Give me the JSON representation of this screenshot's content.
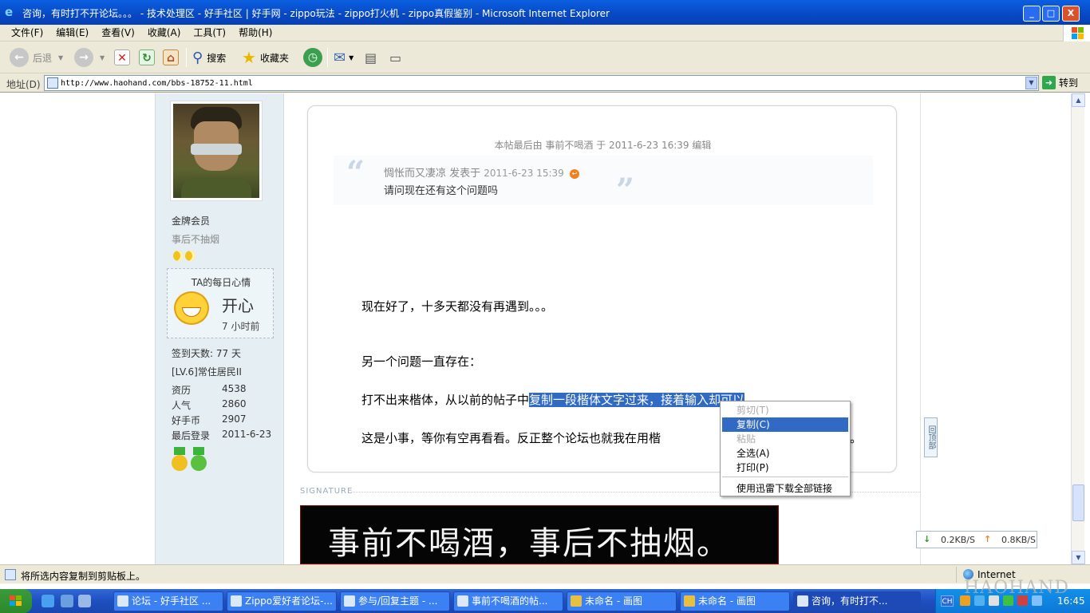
{
  "window": {
    "title": "咨询，有时打不开论坛。。。 - 技术处理区 - 好手社区 | 好手网 - zippo玩法 - zippo打火机 - zippo真假鉴别 - Microsoft Internet Explorer",
    "buttons": {
      "minimize": "_",
      "maximize": "□",
      "close": "X"
    }
  },
  "menubar": [
    "文件(F)",
    "编辑(E)",
    "查看(V)",
    "收藏(A)",
    "工具(T)",
    "帮助(H)"
  ],
  "toolbar": {
    "back": "后退",
    "search": "搜索",
    "favorites": "收藏夹"
  },
  "address": {
    "label": "地址(D)",
    "url": "http://www.haohand.com/bbs-18752-11.html",
    "go": "转到"
  },
  "user": {
    "rank": "金牌会员",
    "name": "事后不抽烟",
    "mood_title": "TA的每日心情",
    "mood": "开心",
    "mood_time": "7 小时前",
    "signin": "签到天数: 77 天",
    "level": "[LV.6]常住居民II",
    "stats": [
      {
        "key": "资历",
        "value": "4538"
      },
      {
        "key": "人气",
        "value": "2860"
      },
      {
        "key": "好手币",
        "value": "2907"
      },
      {
        "key": "最后登录",
        "value": "2011-6-23"
      }
    ]
  },
  "post": {
    "edited": "本帖最后由 事前不喝酒 于 2011-6-23 16:39 编辑",
    "quote_author": "惆怅而又凄凉 发表于",
    "quote_date": "2011-6-23 15:39",
    "quote_text": "请问现在还有这个问题吗",
    "line1": "现在好了，十多天都没有再遇到。。。",
    "line2": "另一个问题一直存在：",
    "line3_plain": "打不出来楷体，从以前的帖子中",
    "line3_selected": "复制一段楷体文字过来，接着输入却可以",
    "line4": "这是小事，等你有空再看看。反正整个论坛也就我在用楷",
    "line4_tail": "。"
  },
  "signature": {
    "label": "SIGNATURE",
    "text": "事前不喝酒，事后不抽烟。"
  },
  "backtop": "回顶部",
  "context_menu": [
    {
      "label": "剪切(T)",
      "state": "disabled"
    },
    {
      "label": "复制(C)",
      "state": "active"
    },
    {
      "label": "粘贴",
      "state": "disabled"
    },
    {
      "label": "全选(A)",
      "state": "normal"
    },
    {
      "label": "打印(P)",
      "state": "normal"
    },
    {
      "label": "使用迅雷下载全部链接",
      "state": "normal"
    }
  ],
  "speed": {
    "down": "0.2KB/S",
    "up": "0.8KB/S"
  },
  "status": {
    "text": "将所选内容复制到剪贴板上。",
    "zone": "Internet"
  },
  "taskbar": {
    "tasks": [
      "论坛 - 好手社区 ...",
      "Zippo爱好者论坛-...",
      "参与/回复主题 - ...",
      "事前不喝酒的帖...",
      "未命名 - 画图",
      "未命名 - 画图",
      "咨询，有时打不..."
    ],
    "lang": "CH",
    "clock": "16:45"
  },
  "watermark": "HAOHAND",
  "colors": {
    "selection": "#316ac5",
    "sidebar": "#e5eef3",
    "titlebar": "#0848c4"
  }
}
